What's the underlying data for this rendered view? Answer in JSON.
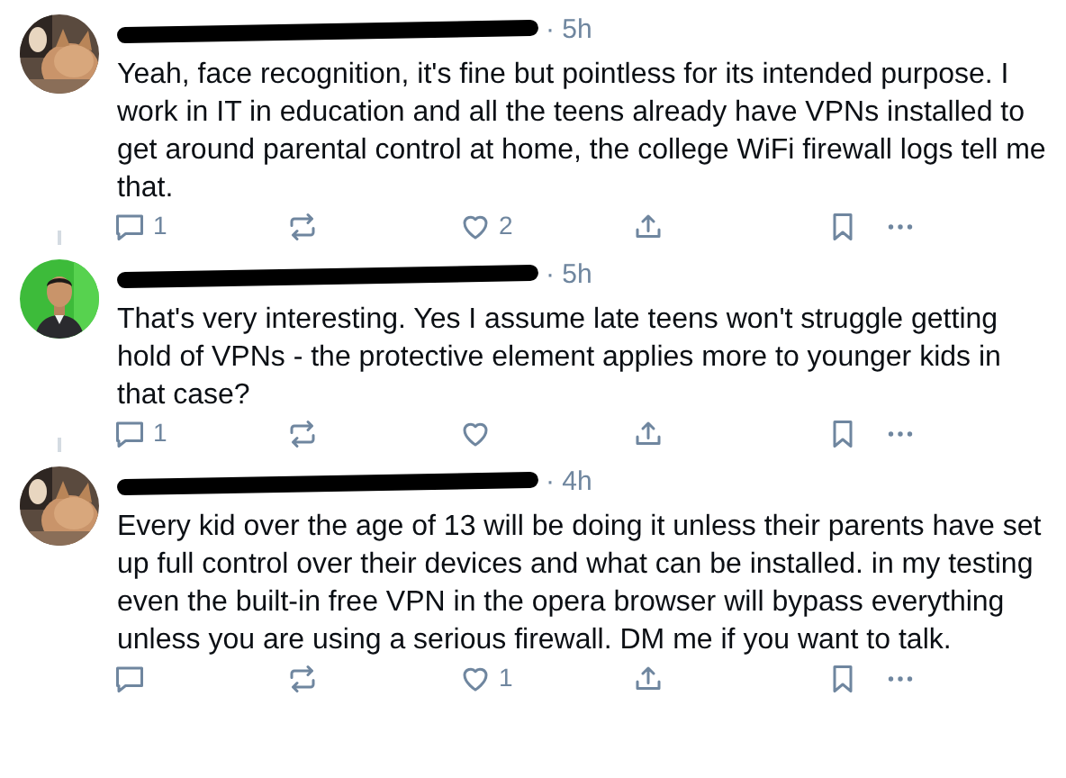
{
  "posts": [
    {
      "time": "· 5h",
      "text": "Yeah, face recognition, it's fine but pointless for its intended purpose. I work in IT in education and all the teens already have VPNs installed to get around parental control at home, the college WiFi firewall logs tell me that.",
      "replies": "1",
      "likes": "2",
      "thread_line_below": true
    },
    {
      "time": "· 5h",
      "text": "That's very interesting. Yes I assume late teens won't struggle getting hold of VPNs - the protective element applies more to younger kids in that case?",
      "replies": "1",
      "thread_line_below": true
    },
    {
      "time": "· 4h",
      "text": "Every kid over the age of 13 will be doing it unless their parents have set up full control over their devices and what can be installed. in my testing even the built-in free VPN in the opera browser will bypass everything unless you are using a serious firewall. DM me if you want to talk.",
      "likes": "1",
      "thread_line_below": false
    }
  ]
}
